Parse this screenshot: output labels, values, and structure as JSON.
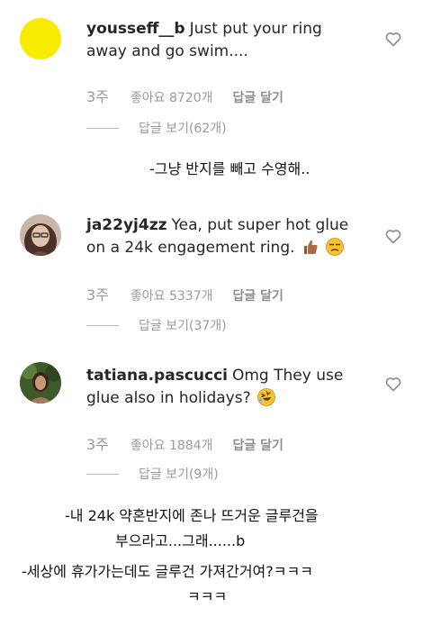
{
  "comments": [
    {
      "username": "yousseff__b",
      "text": "Just put your ring away and go swim....",
      "time": "3주",
      "likes": "좋아요 8720개",
      "reply": "답글 달기",
      "view_replies": "답글 보기(62개)",
      "avatar_color": "#f7ec00"
    },
    {
      "username": "ja22yj4zz",
      "text": "Yea, put super hot glue on a 24k engagement ring.",
      "time": "3주",
      "likes": "좋아요 5337개",
      "reply": "답글 달기",
      "view_replies": "답글 보기(37개)",
      "emojis": [
        "thumbs-up-icon",
        "unamused-face-icon"
      ]
    },
    {
      "username": "tatiana.pascucci",
      "text": "Omg They use glue also in holidays?",
      "time": "3주",
      "likes": "좋아요 1884개",
      "reply": "답글 달기",
      "view_replies": "답글 보기(9개)",
      "emojis": [
        "rolling-laughing-face-icon"
      ]
    }
  ],
  "captions": {
    "first": "-그냥 반지를 빼고 수영해..",
    "second_line1": "-내 24k 약혼반지에 존나 뜨거운 글루건을",
    "second_line2": "부으라고...그래......b",
    "third_line1": "-세상에 휴가가는데도 글루건 가져간거여?ㅋㅋㅋ",
    "third_line2": "ㅋㅋㅋ"
  },
  "colors": {
    "meta_gray": "#9a9a9a",
    "text": "#262626"
  }
}
